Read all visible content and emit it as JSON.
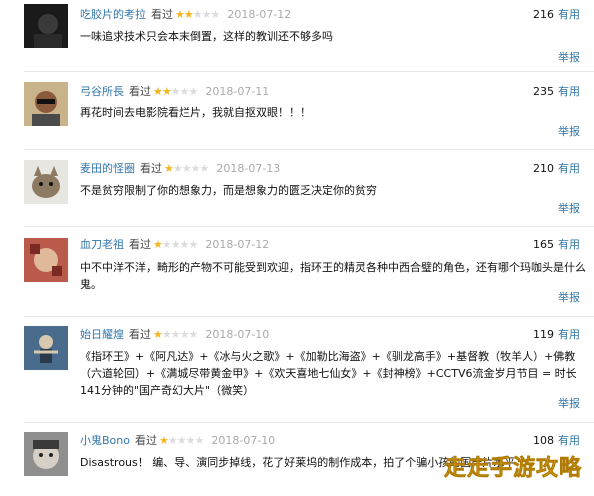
{
  "comments": [
    {
      "user": "吃胶片的考拉",
      "action": "看过",
      "rating": 2,
      "date": "2018-07-12",
      "votes": "216",
      "useful_label": "有用",
      "text": "一味追求技术只会本末倒置，这样的教训还不够多吗",
      "report": "举报",
      "avatar_icon": "dark-portrait-avatar"
    },
    {
      "user": "弓谷所長",
      "action": "看过",
      "rating": 2,
      "date": "2018-07-11",
      "votes": "235",
      "useful_label": "有用",
      "text": "再花时间去电影院看烂片，我就自抠双眼！！！",
      "report": "举报",
      "avatar_icon": "man-sunglasses-avatar"
    },
    {
      "user": "麦田的怪圈",
      "action": "看过",
      "rating": 1,
      "date": "2018-07-13",
      "votes": "210",
      "useful_label": "有用",
      "text": "不是贫穷限制了你的想象力，而是想象力的匮乏决定你的贫穷",
      "report": "举报",
      "avatar_icon": "cat-avatar"
    },
    {
      "user": "血刀老祖",
      "action": "看过",
      "rating": 1,
      "date": "2018-07-12",
      "votes": "165",
      "useful_label": "有用",
      "text": "中不中洋不洋，畸形的产物不可能受到欢迎，指环王的精灵各种中西合璧的角色，还有哪个玛咖头是什么鬼。",
      "report": "举报",
      "avatar_icon": "hands-avatar"
    },
    {
      "user": "始日耀煌",
      "action": "看过",
      "rating": 1,
      "date": "2018-07-10",
      "votes": "119",
      "useful_label": "有用",
      "text": "《指环王》+《阿凡达》+《冰与火之歌》+《加勒比海盗》+《驯龙高手》+基督教（牧羊人）+佛教（六道轮回）+《满城尽带黄金甲》+《欢天喜地七仙女》+《封神榜》+CCTV6流金岁月节目 = 时长141分钟的\"国产奇幻大片\"（微笑）",
      "report": "举报",
      "avatar_icon": "figure-avatar"
    },
    {
      "user": "小鬼Bono",
      "action": "看过",
      "rating": 1,
      "date": "2018-07-10",
      "votes": "108",
      "useful_label": "有用",
      "text": "Disastrous！ 编、导、演同步掉线，花了好莱坞的制作成本，拍了个骗小孩的国产片水平…",
      "report": "",
      "avatar_icon": "child-face-avatar"
    }
  ],
  "watermark": "走走手游攻略",
  "colors": {
    "link": "#3377aa",
    "star_on": "#f4b51d",
    "star_off": "#dcdcdc",
    "date": "#aaaaaa"
  }
}
